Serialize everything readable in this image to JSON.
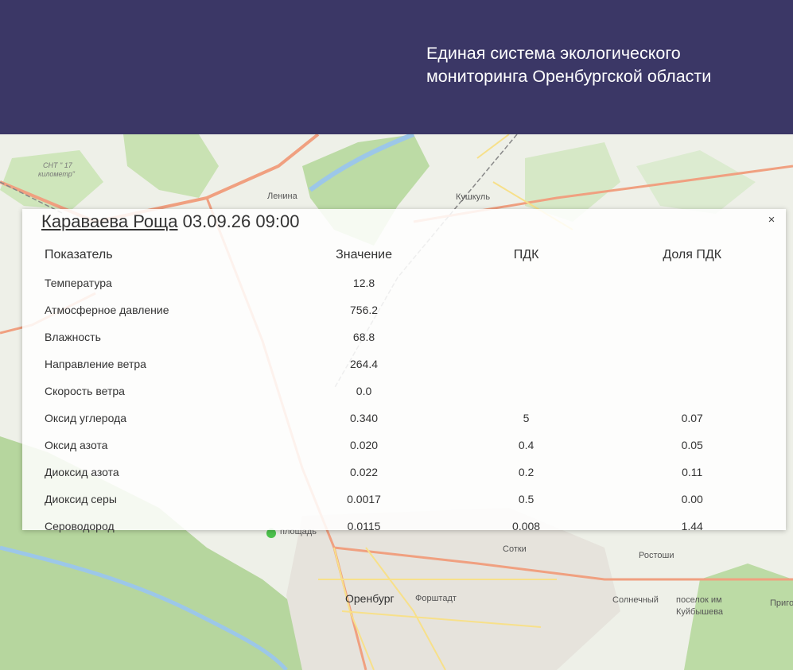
{
  "header": {
    "title_line1": "Единая система экологического",
    "title_line2": "мониторинга Оренбургской области"
  },
  "map": {
    "labels": {
      "lenina": "Ленина",
      "kushkul": "Кушкуль",
      "orenburg": "Оренбург",
      "forshtadt": "Форштадт",
      "sotki": "Сотки",
      "rostoshi": "Ростоши",
      "solnechny": "Солнечный",
      "kuibysheva_1": "поселок им",
      "kuibysheva_2": "Куйбышева",
      "snt17_1": "СНТ \" 17",
      "snt17_2": "километр\"",
      "ploshchad": "площадь",
      "prigo": "Приго"
    }
  },
  "popup": {
    "station": "Караваева Роща",
    "datetime": "03.09.26 09:00",
    "close_glyph": "×",
    "columns": [
      "Показатель",
      "Значение",
      "ПДК",
      "Доля ПДК"
    ],
    "rows": [
      {
        "name": "Температура",
        "value": "12.8",
        "pdk": "",
        "share": ""
      },
      {
        "name": "Атмосферное давление",
        "value": "756.2",
        "pdk": "",
        "share": ""
      },
      {
        "name": "Влажность",
        "value": "68.8",
        "pdk": "",
        "share": ""
      },
      {
        "name": "Направление ветра",
        "value": "264.4",
        "pdk": "",
        "share": ""
      },
      {
        "name": "Скорость ветра",
        "value": "0.0",
        "pdk": "",
        "share": ""
      },
      {
        "name": "Оксид углерода",
        "value": "0.340",
        "pdk": "5",
        "share": "0.07"
      },
      {
        "name": "Оксид азота",
        "value": "0.020",
        "pdk": "0.4",
        "share": "0.05"
      },
      {
        "name": "Диоксид азота",
        "value": "0.022",
        "pdk": "0.2",
        "share": "0.11"
      },
      {
        "name": "Диоксид серы",
        "value": "0.0017",
        "pdk": "0.5",
        "share": "0.00"
      },
      {
        "name": "Сероводород",
        "value": "0.0115",
        "pdk": "0.008",
        "share": "1.44"
      }
    ]
  },
  "colors": {
    "header_bg": "#3b3766",
    "map_bg": "#eef0e8",
    "forest": "#bcd9a8",
    "road_major": "#f0a080",
    "road_minor": "#f7e08a",
    "river": "#9cc7e8",
    "marker": "#4cc24c"
  }
}
